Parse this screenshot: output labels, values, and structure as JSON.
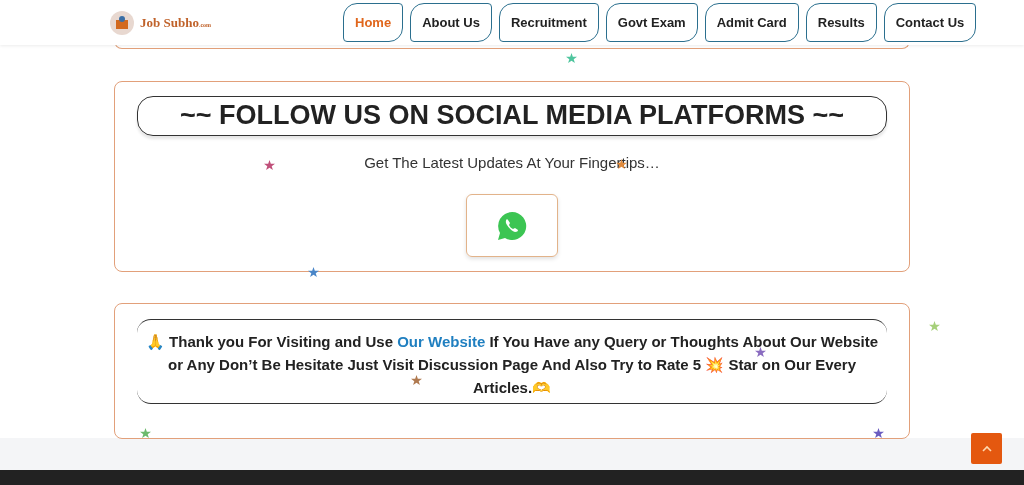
{
  "header": {
    "logo_text": "Job Subho$_{.com}$"
  },
  "nav": [
    {
      "label": "Home",
      "selected": true
    },
    {
      "label": "About Us",
      "selected": false
    },
    {
      "label": "Recruitment",
      "selected": false
    },
    {
      "label": "Govt Exam",
      "selected": false
    },
    {
      "label": "Admit Card",
      "selected": false
    },
    {
      "label": "Results",
      "selected": false
    },
    {
      "label": "Contact Us",
      "selected": false
    }
  ],
  "social": {
    "title": "~~ FOLLOW US ON SOCIAL MEDIA PLATFORMS ~~",
    "subtitle": "Get The Latest Updates At Your Fingertips…"
  },
  "thanks": {
    "before": "🙏 Thank you For Visiting and Use ",
    "link": "Our Website",
    "after": " If You Have any Query or Thoughts About Our Website or Any Don’t Be Hesitate Just Visit Discussion Page And Also Try to Rate 5 💥 Star on Our Every Articles.🫶"
  },
  "stars": [
    {
      "color": "#4fc59e"
    },
    {
      "color": "#c0507a"
    },
    {
      "color": "#e08a3c"
    },
    {
      "color": "#4a86c8"
    },
    {
      "color": "#a6d07a"
    },
    {
      "color": "#8a6cc0"
    },
    {
      "color": "#b07a50"
    },
    {
      "color": "#6cba6c"
    },
    {
      "color": "#6a5cc0"
    }
  ]
}
